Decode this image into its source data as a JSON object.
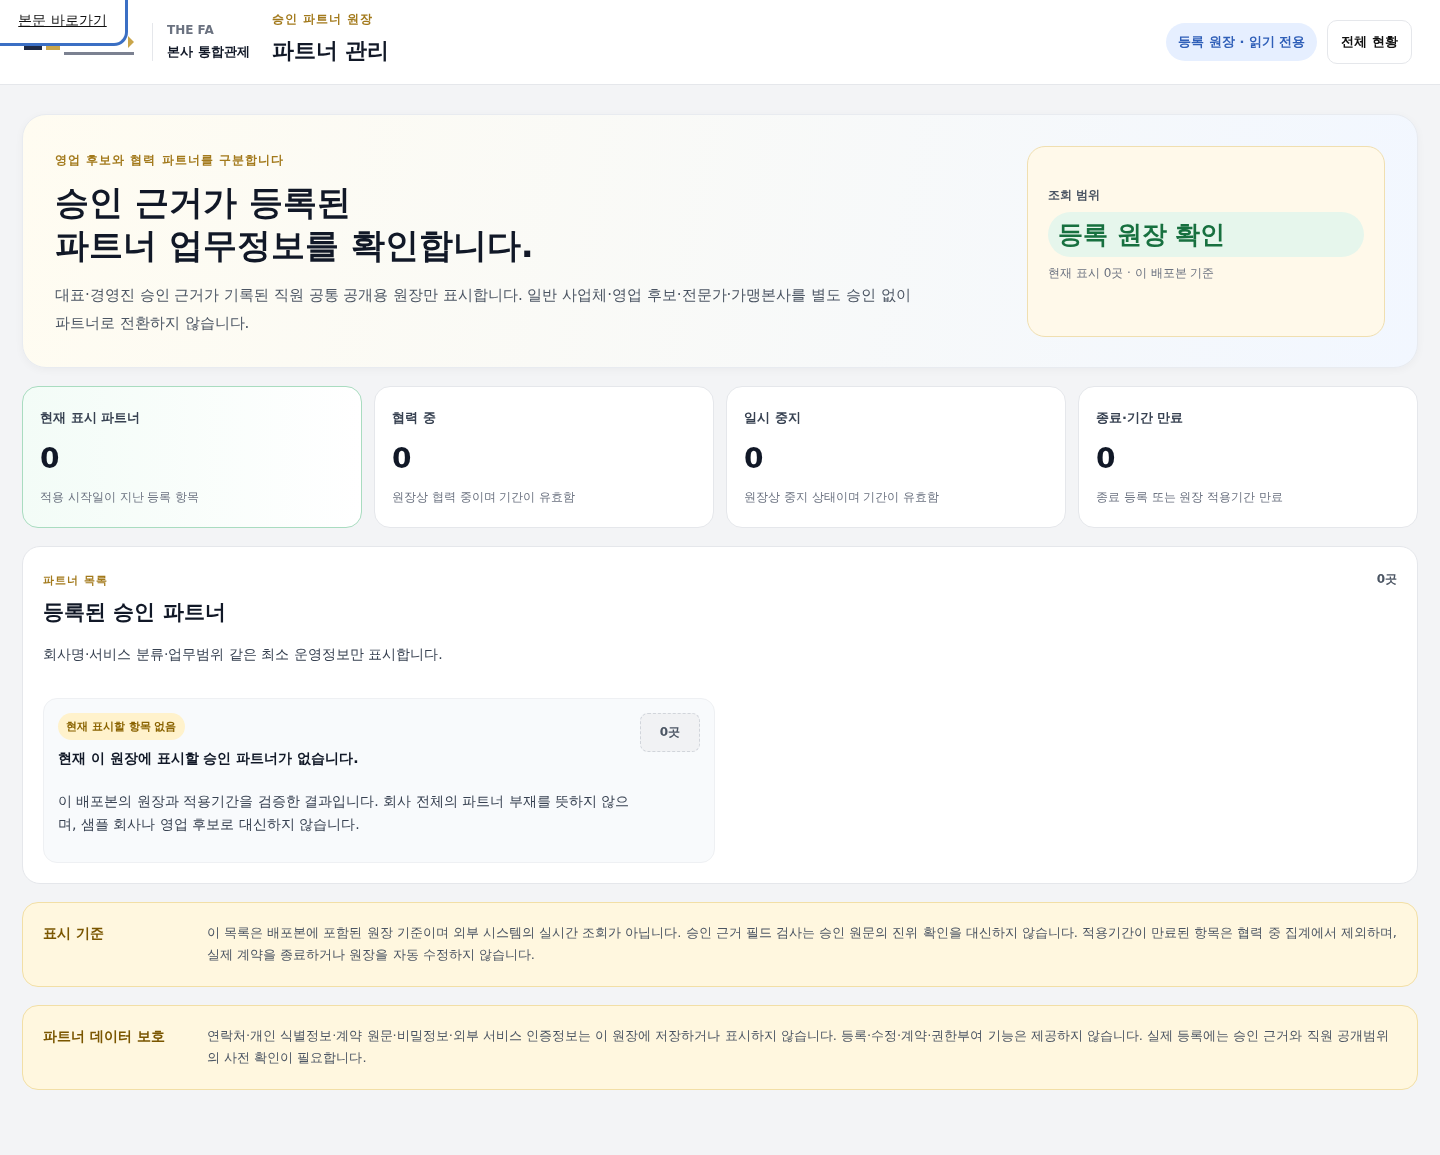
{
  "skip_link": "본문 바로가기",
  "brand": {
    "org": "THE FA",
    "unit": "본사 통합관제"
  },
  "page": {
    "eyebrow": "승인 파트너 원장",
    "title": "파트너 관리"
  },
  "header_actions": {
    "badge": "등록 원장 · 읽기 전용",
    "button": "전체 현황"
  },
  "hero": {
    "eyebrow": "영업 후보와 협력 파트너를 구분합니다",
    "title_lines": [
      "승인 근거가 등록된",
      "파트너 업무정보를 확인합니다."
    ],
    "description": "대표·경영진 승인 근거가 기록된 직원 공통 공개용 원장만 표시합니다. 일반 사업체·영업 후보·전문가·가맹본사를 별도 승인 없이 파트너로 전환하지 않습니다.",
    "scope": {
      "label": "조회 범위",
      "value": "등록 원장 확인",
      "note": "현재 표시 0곳 · 이 배포본 기준"
    }
  },
  "stats": [
    {
      "label": "현재 표시 파트너",
      "value": "0",
      "note": "적용 시작일이 지난 등록 항목",
      "selected": true
    },
    {
      "label": "협력 중",
      "value": "0",
      "note": "원장상 협력 중이며 기간이 유효함",
      "selected": false
    },
    {
      "label": "일시 중지",
      "value": "0",
      "note": "원장상 중지 상태이며 기간이 유효함",
      "selected": false
    },
    {
      "label": "종료·기간 만료",
      "value": "0",
      "note": "종료 등록 또는 원장 적용기간 만료",
      "selected": false
    }
  ],
  "list": {
    "eyebrow": "파트너 목록",
    "title": "등록된 승인 파트너",
    "count": "0곳",
    "description": "회사명·서비스 분류·업무범위 같은 최소 운영정보만 표시합니다.",
    "empty": {
      "tag": "현재 표시할 항목 없음",
      "count": "0곳",
      "title": "현재 이 원장에 표시할 승인 파트너가 없습니다.",
      "body": "이 배포본의 원장과 적용기간을 검증한 결과입니다. 회사 전체의 파트너 부재를 뜻하지 않으며, 샘플 회사나 영업 후보로 대신하지 않습니다."
    }
  },
  "notices": [
    {
      "title": "표시 기준",
      "body": "이 목록은 배포본에 포함된 원장 기준이며 외부 시스템의 실시간 조회가 아닙니다. 승인 근거 필드 검사는 승인 원문의 진위 확인을 대신하지 않습니다. 적용기간이 만료된 항목은 협력 중 집계에서 제외하며, 실제 계약을 종료하거나 원장을 자동 수정하지 않습니다."
    },
    {
      "title": "파트너 데이터 보호",
      "body": "연락처·개인 식별정보·계약 원문·비밀정보·외부 서비스 인증정보는 이 원장에 저장하거나 표시하지 않습니다. 등록·수정·계약·권한부여 기능은 제공하지 않습니다. 실제 등록에는 승인 근거와 직원 공개범위의 사전 확인이 필요합니다."
    }
  ]
}
